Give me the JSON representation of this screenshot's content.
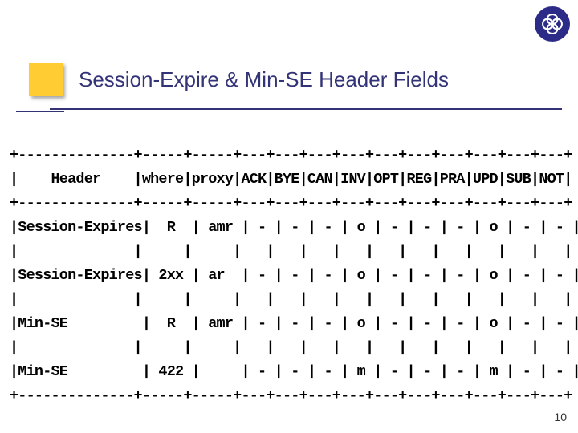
{
  "title": "Session-Expire & Min-SE Header Fields",
  "page_number": "10",
  "logo_name": "network-knot-logo",
  "table": {
    "border": "+--------------+-----+-----+---+---+---+---+---+---+---+---+---+---+",
    "header": "|    Header    |where|proxy|ACK|BYE|CAN|INV|OPT|REG|PRA|UPD|SUB|NOT|",
    "spacer": "|              |     |     |   |   |   |   |   |   |   |   |   |   |",
    "rows": [
      "|Session-Expires|  R  | amr | - | - | - | o | - | - | - | o | - | - |",
      "|Session-Expires| 2xx | ar  | - | - | - | o | - | - | - | o | - | - |",
      "|Min‑SE         |  R  | amr | - | - | - | o | - | - | - | o | - | - |",
      "|Min‑SE         | 422 |     | - | - | - | m | - | - | - | m | - | - |"
    ]
  }
}
